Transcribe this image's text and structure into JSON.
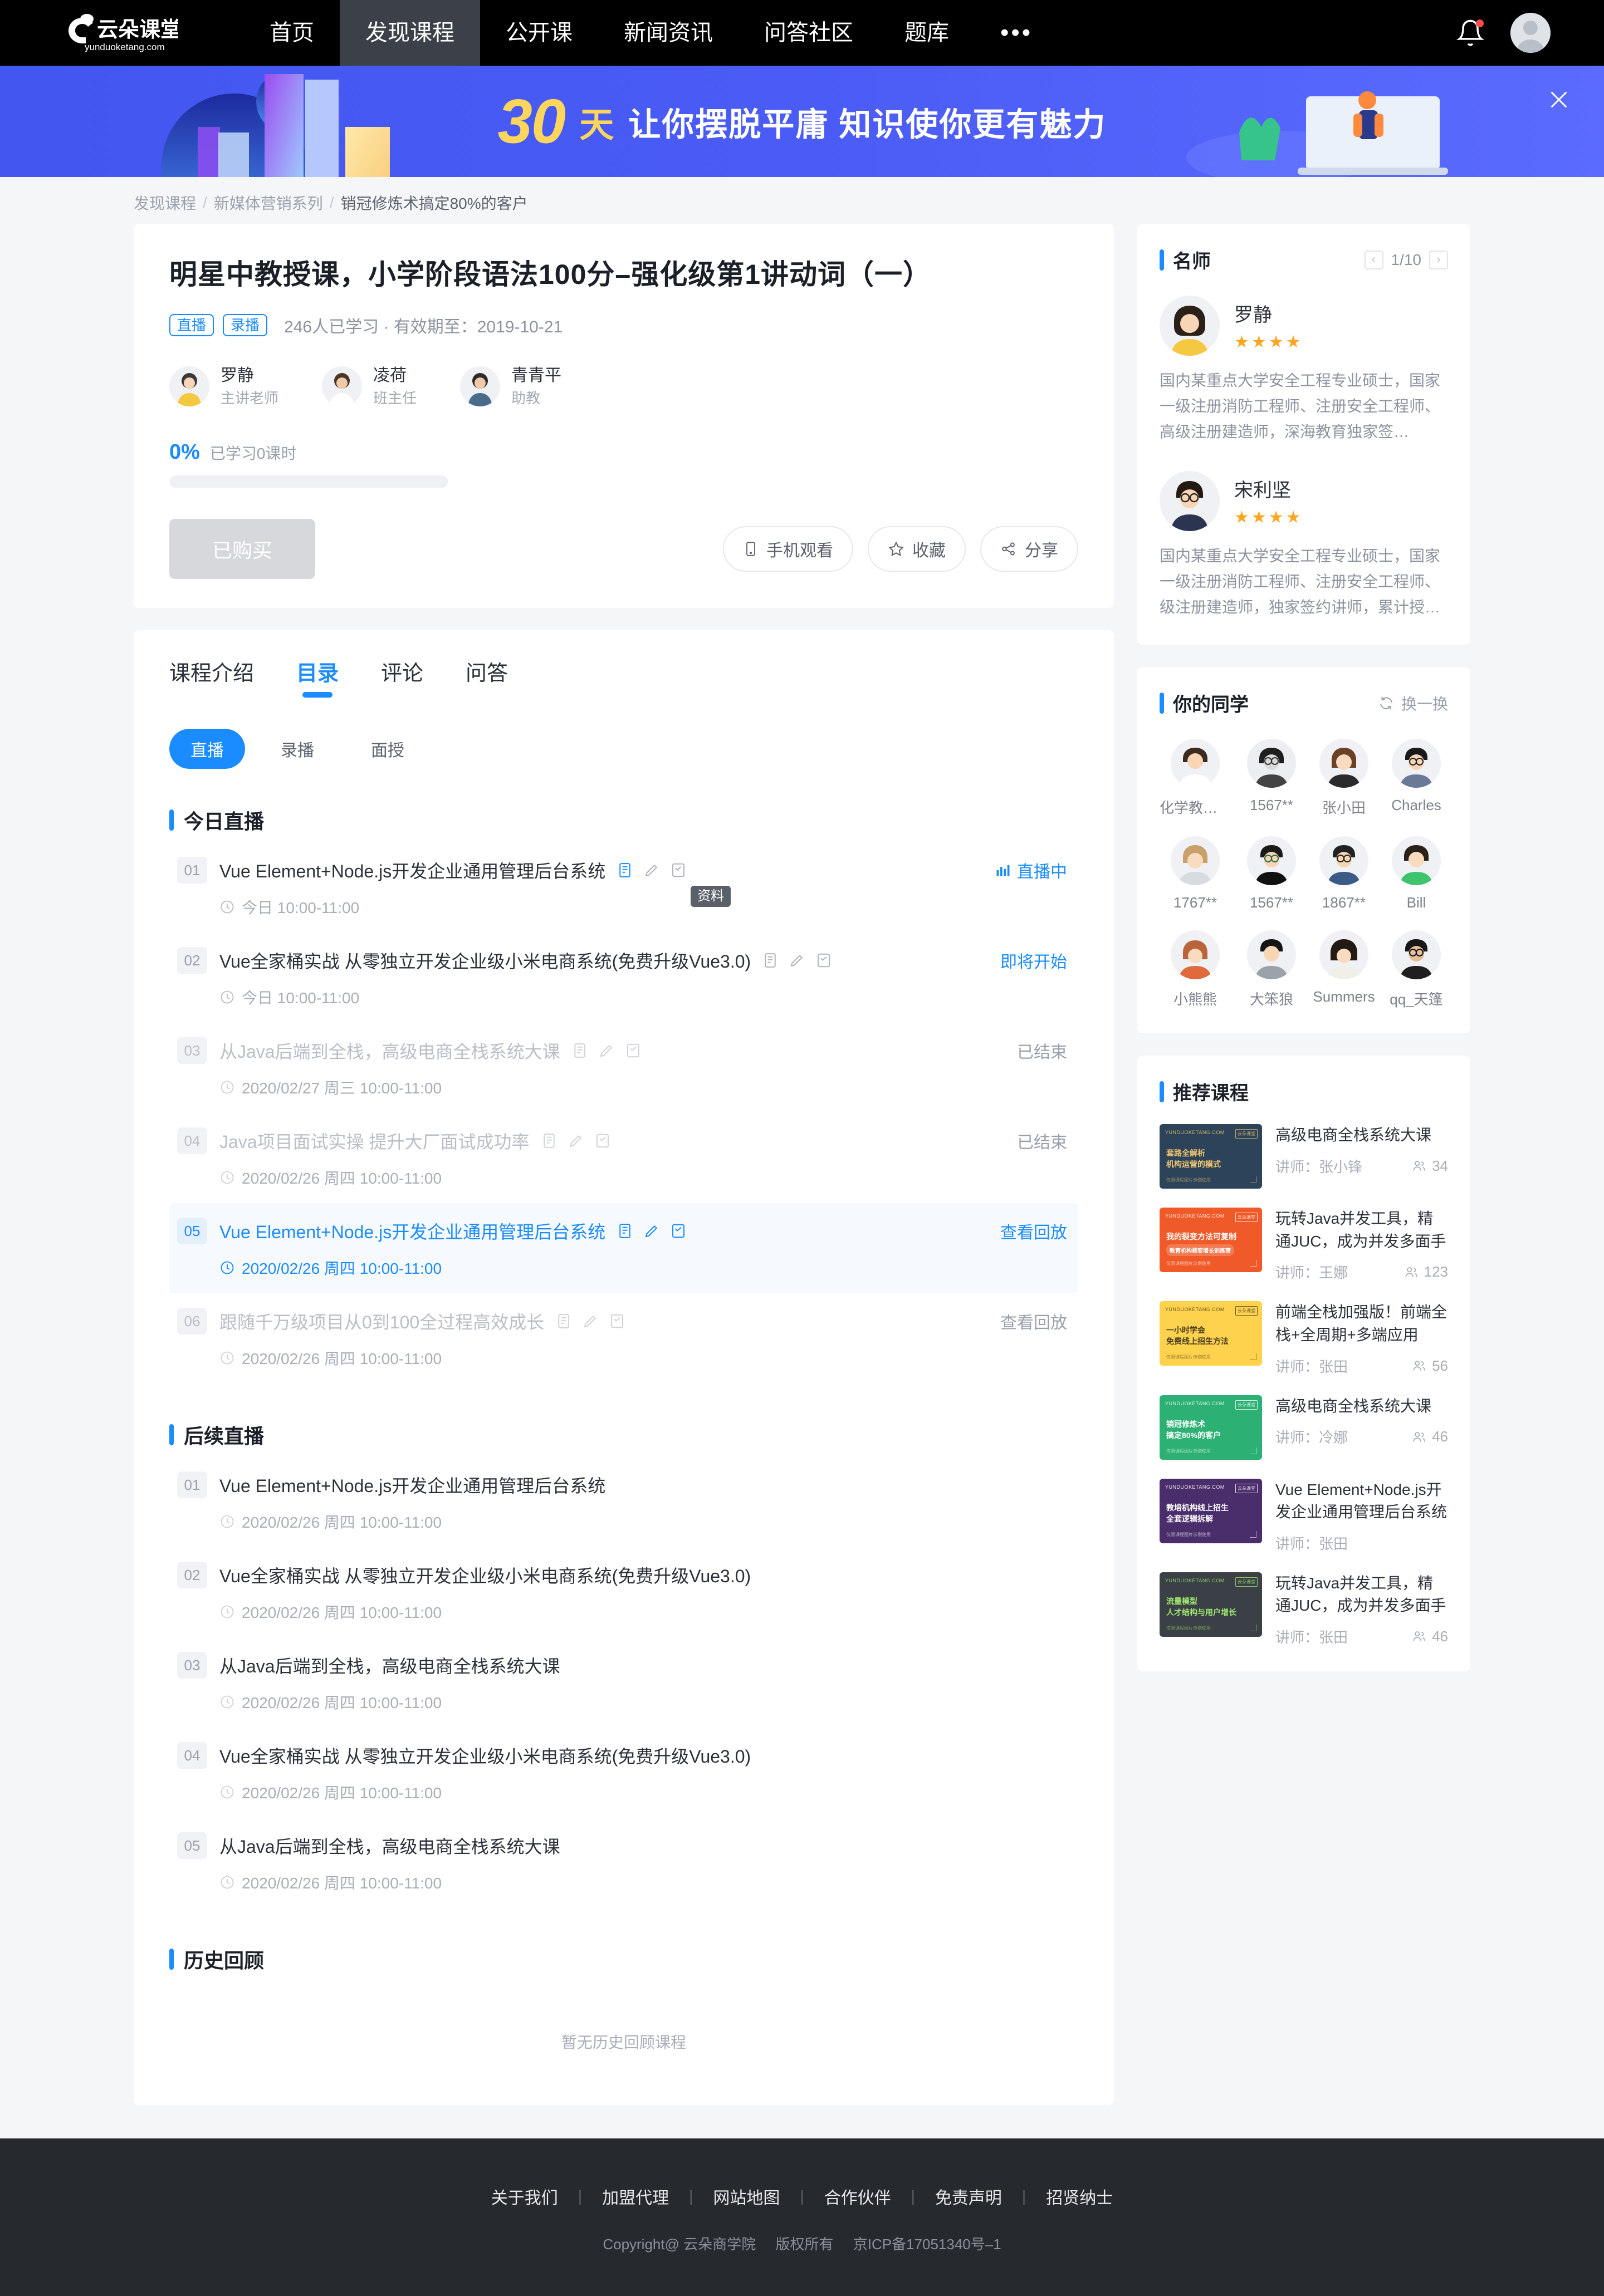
{
  "nav": {
    "brand_cn": "云朵课堂",
    "brand_en": "yunduoketang.com",
    "items": [
      {
        "label": "首页",
        "active": false
      },
      {
        "label": "发现课程",
        "active": true
      },
      {
        "label": "公开课",
        "active": false
      },
      {
        "label": "新闻资讯",
        "active": false
      },
      {
        "label": "问答社区",
        "active": false
      },
      {
        "label": "题库",
        "active": false
      }
    ],
    "more": "•••"
  },
  "banner": {
    "num": "30",
    "day": "天",
    "rest": "让你摆脱平庸 知识使你更有魅力",
    "close": "×"
  },
  "breadcrumb": [
    "发现课程",
    "新媒体营销系列",
    "销冠修炼术搞定80%的客户"
  ],
  "course": {
    "title": "明星中教授课，小学阶段语法100分–强化级第1讲动词（一）",
    "tags": [
      "直播",
      "录播"
    ],
    "meta": "246人已学习 · 有效期至：2019-10-21",
    "teachers": [
      {
        "name": "罗静",
        "role": "主讲老师"
      },
      {
        "name": "凌荷",
        "role": "班主任"
      },
      {
        "name": "青青平",
        "role": "助教"
      }
    ],
    "progress_pct": "0%",
    "progress_label": "已学习0课时",
    "progress_value": 0,
    "buy_button": "已购买",
    "actions": [
      {
        "label": "手机观看",
        "icon": "phone-icon"
      },
      {
        "label": "收藏",
        "icon": "star-icon"
      },
      {
        "label": "分享",
        "icon": "share-icon"
      }
    ]
  },
  "tabs": [
    {
      "label": "课程介绍",
      "active": false
    },
    {
      "label": "目录",
      "active": true
    },
    {
      "label": "评论",
      "active": false
    },
    {
      "label": "问答",
      "active": false
    }
  ],
  "subtabs": [
    {
      "label": "直播",
      "active": true
    },
    {
      "label": "录播",
      "active": false
    },
    {
      "label": "面授",
      "active": false
    }
  ],
  "tooltip": "资料",
  "sections": [
    {
      "title": "今日直播",
      "lessons": [
        {
          "num": "01",
          "title": "Vue Element+Node.js开发企业通用管理后台系统",
          "time": "今日 10:00-11:00",
          "status": "直播中",
          "state": "live",
          "icons": true
        },
        {
          "num": "02",
          "title": "Vue全家桶实战 从零独立开发企业级小米电商系统(免费升级Vue3.0)",
          "time": "今日 10:00-11:00",
          "status": "即将开始",
          "state": "soon",
          "icons": true
        },
        {
          "num": "03",
          "title": "从Java后端到全栈，高级电商全栈系统大课",
          "time": "2020/02/27 周三 10:00-11:00",
          "status": "已结束",
          "state": "dim",
          "icons": true
        },
        {
          "num": "04",
          "title": "Java项目面试实操 提升大厂面试成功率",
          "time": "2020/02/26 周四 10:00-11:00",
          "status": "已结束",
          "state": "dim",
          "icons": true
        },
        {
          "num": "05",
          "title": "Vue Element+Node.js开发企业通用管理后台系统",
          "time": "2020/02/26 周四 10:00-11:00",
          "status": "查看回放",
          "state": "highlight",
          "icons": true
        },
        {
          "num": "06",
          "title": "跟随千万级项目从0到100全过程高效成长",
          "time": "2020/02/26 周四 10:00-11:00",
          "status": "查看回放",
          "state": "dim",
          "icons": true
        }
      ]
    },
    {
      "title": "后续直播",
      "lessons": [
        {
          "num": "01",
          "title": "Vue Element+Node.js开发企业通用管理后台系统",
          "time": "2020/02/26 周四 10:00-11:00",
          "status": "",
          "state": "plain",
          "icons": false
        },
        {
          "num": "02",
          "title": "Vue全家桶实战 从零独立开发企业级小米电商系统(免费升级Vue3.0)",
          "time": "2020/02/26 周四 10:00-11:00",
          "status": "",
          "state": "plain",
          "icons": false
        },
        {
          "num": "03",
          "title": "从Java后端到全栈，高级电商全栈系统大课",
          "time": "2020/02/26 周四 10:00-11:00",
          "status": "",
          "state": "plain",
          "icons": false
        },
        {
          "num": "04",
          "title": "Vue全家桶实战 从零独立开发企业级小米电商系统(免费升级Vue3.0)",
          "time": "2020/02/26 周四 10:00-11:00",
          "status": "",
          "state": "plain",
          "icons": false
        },
        {
          "num": "05",
          "title": "从Java后端到全栈，高级电商全栈系统大课",
          "time": "2020/02/26 周四 10:00-11:00",
          "status": "",
          "state": "plain",
          "icons": false
        }
      ]
    },
    {
      "title": "历史回顾",
      "lessons": [],
      "empty": "暂无历史回顾课程"
    }
  ],
  "sidebar": {
    "famous": {
      "title": "名师",
      "page": "1/10",
      "prev": "‹",
      "next": "›",
      "list": [
        {
          "name": "罗静",
          "stars": "★★★★",
          "desc": "国内某重点大学安全工程专业硕士，国家一级注册消防工程师、注册安全工程师、高级注册建造师，深海教育独家签…"
        },
        {
          "name": "宋利坚",
          "stars": "★★★★",
          "desc": "国内某重点大学安全工程专业硕士，国家一级注册消防工程师、注册安全工程师、级注册建造师，独家签约讲师，累计授…"
        }
      ]
    },
    "classmates": {
      "title": "你的同学",
      "refresh": "换一换",
      "list": [
        {
          "name": "化学教书…"
        },
        {
          "name": "1567**"
        },
        {
          "name": "张小田"
        },
        {
          "name": "Charles"
        },
        {
          "name": "1767**"
        },
        {
          "name": "1567**"
        },
        {
          "name": "1867**"
        },
        {
          "name": "Bill"
        },
        {
          "name": "小熊熊"
        },
        {
          "name": "大笨狼"
        },
        {
          "name": "Summers"
        },
        {
          "name": "qq_天篷"
        }
      ]
    },
    "recommend": {
      "title": "推荐课程",
      "list": [
        {
          "title": "高级电商全栈系统大课",
          "teacher": "讲师：张小锋",
          "count": "34",
          "thumb_bg": "#2c4359",
          "thumb_fg": "#f0c571",
          "thumb_l1": "套路全解析",
          "thumb_l2": "机构运营的模式",
          "thumb_foot": "仅限课程图片示例使用"
        },
        {
          "title": "玩转Java并发工具，精通JUC，成为并发多面手",
          "teacher": "讲师：王娜",
          "count": "123",
          "thumb_bg": "#f05a28",
          "thumb_fg": "#ffffff",
          "thumb_l1": "我的裂变方法可复制",
          "thumb_l2": "教育机构裂变增长训练营",
          "thumb_foot": "仅限课程图片示例使用"
        },
        {
          "title": "前端全栈加强版！前端全栈+全周期+多端应用",
          "teacher": "讲师：张田",
          "count": "56",
          "thumb_bg": "#ffd24d",
          "thumb_fg": "#3a3520",
          "thumb_l1": "一小时学会",
          "thumb_l2": "免费线上招生方法",
          "thumb_foot": "仅限课程图片示例使用"
        },
        {
          "title": "高级电商全栈系统大课",
          "teacher": "讲师：冷娜",
          "count": "46",
          "thumb_bg": "#2cb073",
          "thumb_fg": "#ffffff",
          "thumb_l1": "销冠修炼术",
          "thumb_l2": "搞定80%的客户",
          "thumb_foot": "仅限课程图片示例使用"
        },
        {
          "title": "Vue Element+Node.js开发企业通用管理后台系统",
          "teacher": "讲师：张田",
          "count": "",
          "thumb_bg": "#4a2d6b",
          "thumb_fg": "#ffffff",
          "thumb_l1": "教培机构线上招生",
          "thumb_l2": "全套逻辑拆解",
          "thumb_foot": "仅限课程图片示例使用"
        },
        {
          "title": "玩转Java并发工具，精通JUC，成为并发多面手",
          "teacher": "讲师：张田",
          "count": "46",
          "thumb_bg": "#3b3f46",
          "thumb_fg": "#9fe870",
          "thumb_l1": "流量模型",
          "thumb_l2": "人才结构与用户增长",
          "thumb_foot": "仅限课程图片示例使用"
        }
      ]
    }
  },
  "footer": {
    "links": [
      "关于我们",
      "加盟代理",
      "网站地图",
      "合作伙伴",
      "免责声明",
      "招贤纳士"
    ],
    "divider": "|",
    "copyright": "Copyright@ 云朵商学院",
    "rights": "版权所有",
    "icp": "京ICP备17051340号–1"
  },
  "colors": {
    "accent": "#1a8cff",
    "banner_bg": "#4a5cf5",
    "banner_text": "#ffd65c",
    "nav_bg": "#000000",
    "footer_bg": "#26292e",
    "star": "#ffa524"
  }
}
